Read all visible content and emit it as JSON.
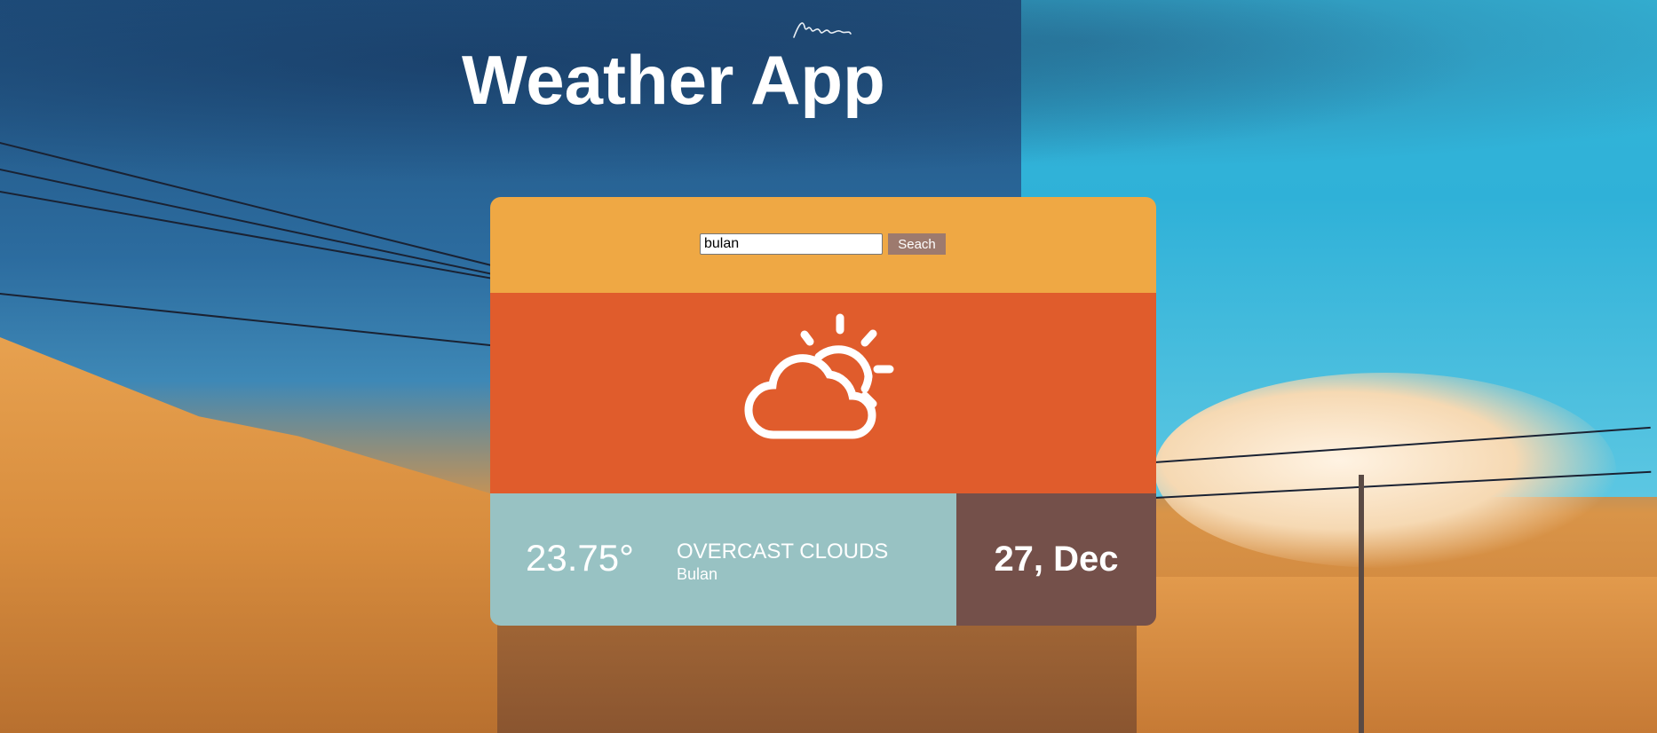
{
  "app": {
    "title": "Weather App"
  },
  "search": {
    "value": "bulan",
    "button_label": "Seach"
  },
  "weather": {
    "icon": "partly-cloudy-icon",
    "temperature": "23.75°",
    "description": "OVERCAST CLOUDS",
    "location": "Bulan",
    "date": "27, Dec"
  },
  "colors": {
    "search_bar": "#efa844",
    "icon_panel": "#e05c2c",
    "info_panel": "#98c2c3",
    "date_panel": "#74504a",
    "search_button": "#9d7a6e"
  }
}
